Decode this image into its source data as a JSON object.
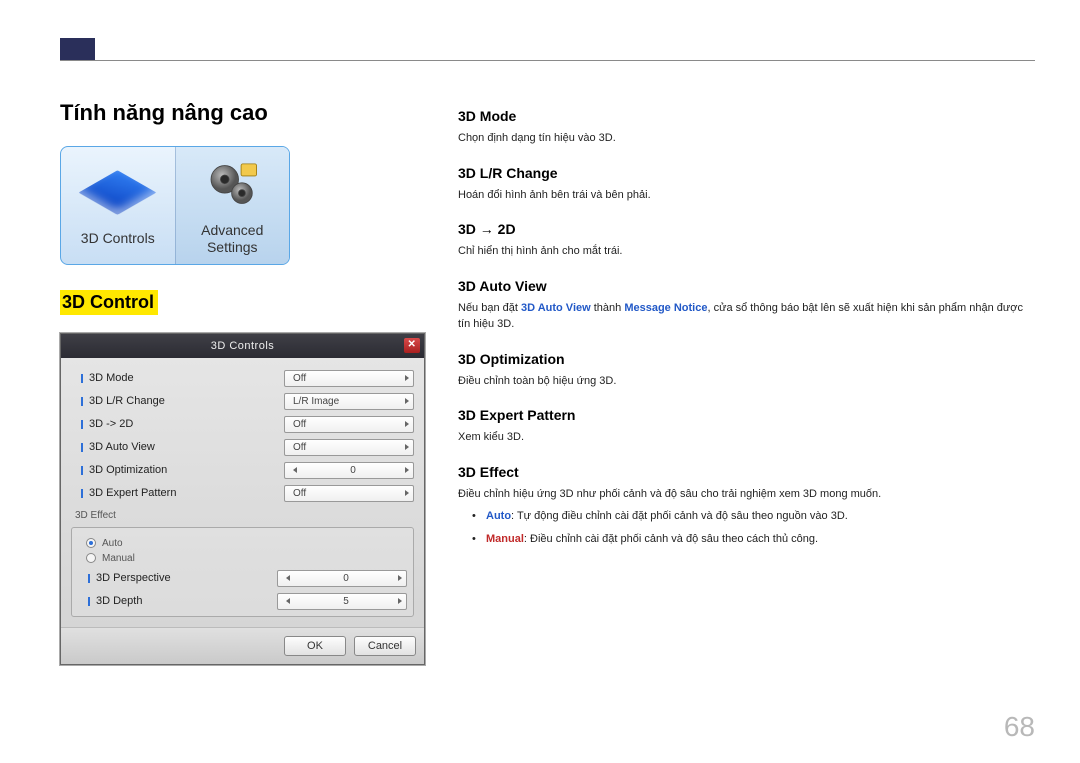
{
  "page_number": "68",
  "section_title": "Tính năng nâng cao",
  "icons": {
    "tile1_label": "3D Controls",
    "tile2_label": "Advanced\nSettings"
  },
  "sub_section_title": "3D Control",
  "dialog": {
    "title": "3D Controls",
    "rows": [
      {
        "label": "3D Mode",
        "value": "Off"
      },
      {
        "label": "3D L/R Change",
        "value": "L/R Image"
      },
      {
        "label": "3D -> 2D",
        "value": "Off"
      },
      {
        "label": "3D Auto View",
        "value": "Off"
      },
      {
        "label": "3D Optimization",
        "value": "0",
        "spin": true
      },
      {
        "label": "3D Expert Pattern",
        "value": "Off"
      }
    ],
    "effect_group": {
      "label": "3D Effect",
      "radio_auto": "Auto",
      "radio_manual": "Manual",
      "rows": [
        {
          "label": "3D Perspective",
          "value": "0"
        },
        {
          "label": "3D Depth",
          "value": "5"
        }
      ]
    },
    "ok": "OK",
    "cancel": "Cancel"
  },
  "definitions": [
    {
      "title": "3D Mode",
      "body": "Chọn định dạng tín hiệu vào 3D."
    },
    {
      "title": "3D L/R Change",
      "body": "Hoán đổi hình ảnh bên trái và bên phải."
    },
    {
      "title": "3D → 2D",
      "body": "Chỉ hiển thị hình ảnh cho mắt trái."
    },
    {
      "title": "3D Auto View",
      "body_pre": "Nếu bạn đặt ",
      "kw1": "3D Auto View",
      "mid": " thành ",
      "kw2": "Message Notice",
      "body_post": ", cửa sổ thông báo bật lên sẽ xuất hiện khi sản phẩm nhận được tín hiệu 3D."
    },
    {
      "title": "3D Optimization",
      "body": "Điều chỉnh toàn bộ hiệu ứng 3D."
    },
    {
      "title": "3D Expert Pattern",
      "body": "Xem kiểu 3D."
    },
    {
      "title": "3D Effect",
      "body": "Điều chỉnh hiệu ứng 3D như phối cảnh và độ sâu cho trải nghiệm xem 3D mong muốn.",
      "bullets": [
        {
          "kw": "Auto",
          "color": "b",
          "text": ": Tự động điều chỉnh cài đặt phối cảnh và độ sâu theo nguồn vào 3D."
        },
        {
          "kw": "Manual",
          "color": "r",
          "text": ": Điều chỉnh cài đặt phối cảnh và độ sâu theo cách thủ công."
        }
      ]
    }
  ]
}
